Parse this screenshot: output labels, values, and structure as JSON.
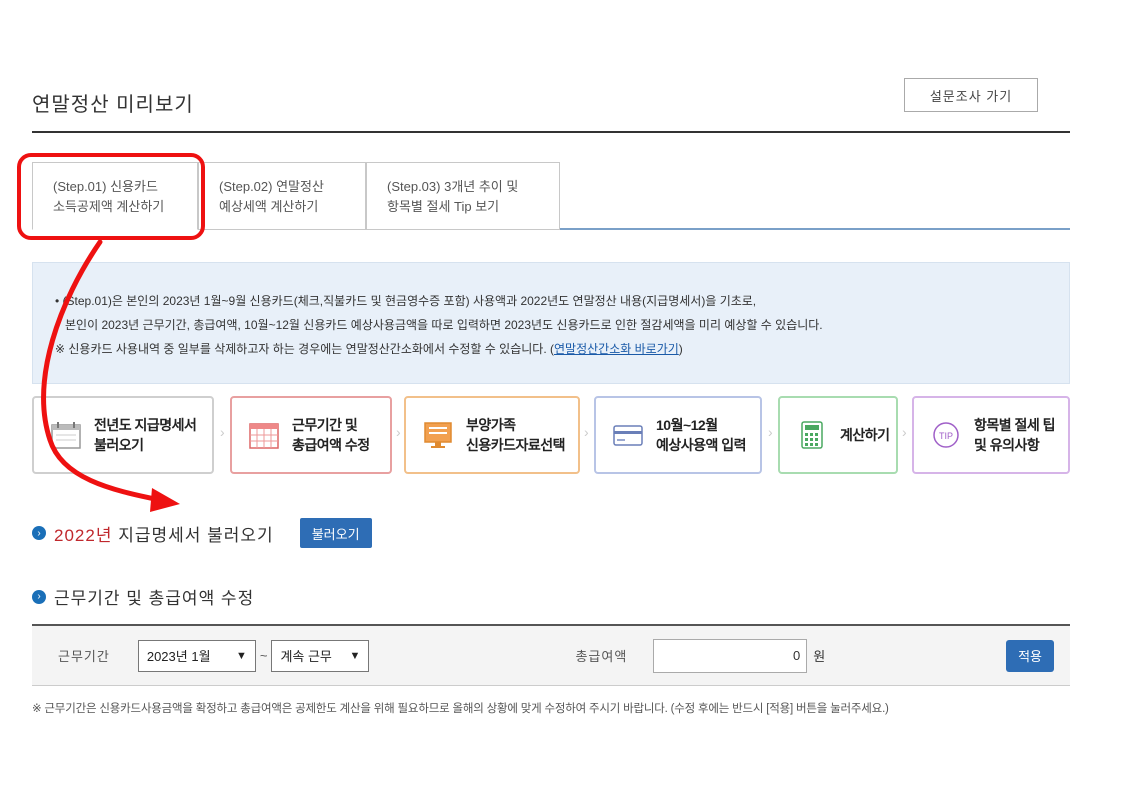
{
  "header": {
    "title": "연말정산 미리보기",
    "survey_button": "설문조사 가기"
  },
  "tabs": [
    {
      "line1": "(Step.01) 신용카드",
      "line2": "소득공제액 계산하기"
    },
    {
      "line1": "(Step.02) 연말정산",
      "line2": "예상세액 계산하기"
    },
    {
      "line1": "(Step.03) 3개년 추이 및",
      "line2": "항목별 절세 Tip 보기"
    }
  ],
  "info": {
    "line1": "• (Step.01)은 본인의 2023년 1월~9월 신용카드(체크,직불카드 및 현금영수증 포함) 사용액과 2022년도 연말정산 내용(지급명세서)을 기초로,",
    "line2": "본인이 2023년 근무기간, 총급여액, 10월~12월 신용카드 예상사용금액을 따로 입력하면 2023년도 신용카드로 인한 절감세액을 미리 예상할 수 있습니다.",
    "line3_text": "※ 신용카드 사용내역 중 일부를 삭제하고자 하는 경우에는 연말정산간소화에서 수정할 수 있습니다. (",
    "line3_link": "연말정산간소화 바로가기",
    "line3_end": ")"
  },
  "steps": [
    {
      "line1": "전년도 지급명세서",
      "line2": "불러오기",
      "icon": "calendar-icon",
      "color": "#cfcfcf"
    },
    {
      "line1": "근무기간 및",
      "line2": "총급여액 수정",
      "icon": "calendar-grid-icon",
      "color": "#e8a0a0"
    },
    {
      "line1": "부양가족",
      "line2": "신용카드자료선택",
      "icon": "monitor-icon",
      "color": "#f2c08a"
    },
    {
      "line1": "10월~12월",
      "line2": "예상사용액 입력",
      "icon": "card-icon",
      "color": "#b8c4e6"
    },
    {
      "line1": "계산하기",
      "line2": "",
      "icon": "calculator-icon",
      "color": "#a8dcb0"
    },
    {
      "line1": "항목별 절세 팁",
      "line2": "및 유의사항",
      "icon": "tip-icon",
      "color": "#d6b4e8"
    }
  ],
  "section1": {
    "year": "2022년",
    "title": " 지급명세서 불러오기",
    "button": "불러오기"
  },
  "section2": {
    "title": "근무기간 및 총급여액 수정"
  },
  "form": {
    "period_label": "근무기간",
    "start_value": "2023년 1월",
    "tilde": "~",
    "end_value": "계속 근무",
    "amount_label": "총급여액",
    "amount_value": "0",
    "won": "원",
    "apply_button": "적용"
  },
  "note": "※ 근무기간은 신용카드사용금액을 확정하고 총급여액은 공제한도 계산을 위해 필요하므로 올해의 상황에 맞게 수정하여 주시기 바랍니다. (수정 후에는 반드시 [적용] 버튼을 눌러주세요.)",
  "colors": {
    "accent_blue": "#2e6db5",
    "highlight_red": "#e11111",
    "info_bg": "#e8f0f9"
  }
}
